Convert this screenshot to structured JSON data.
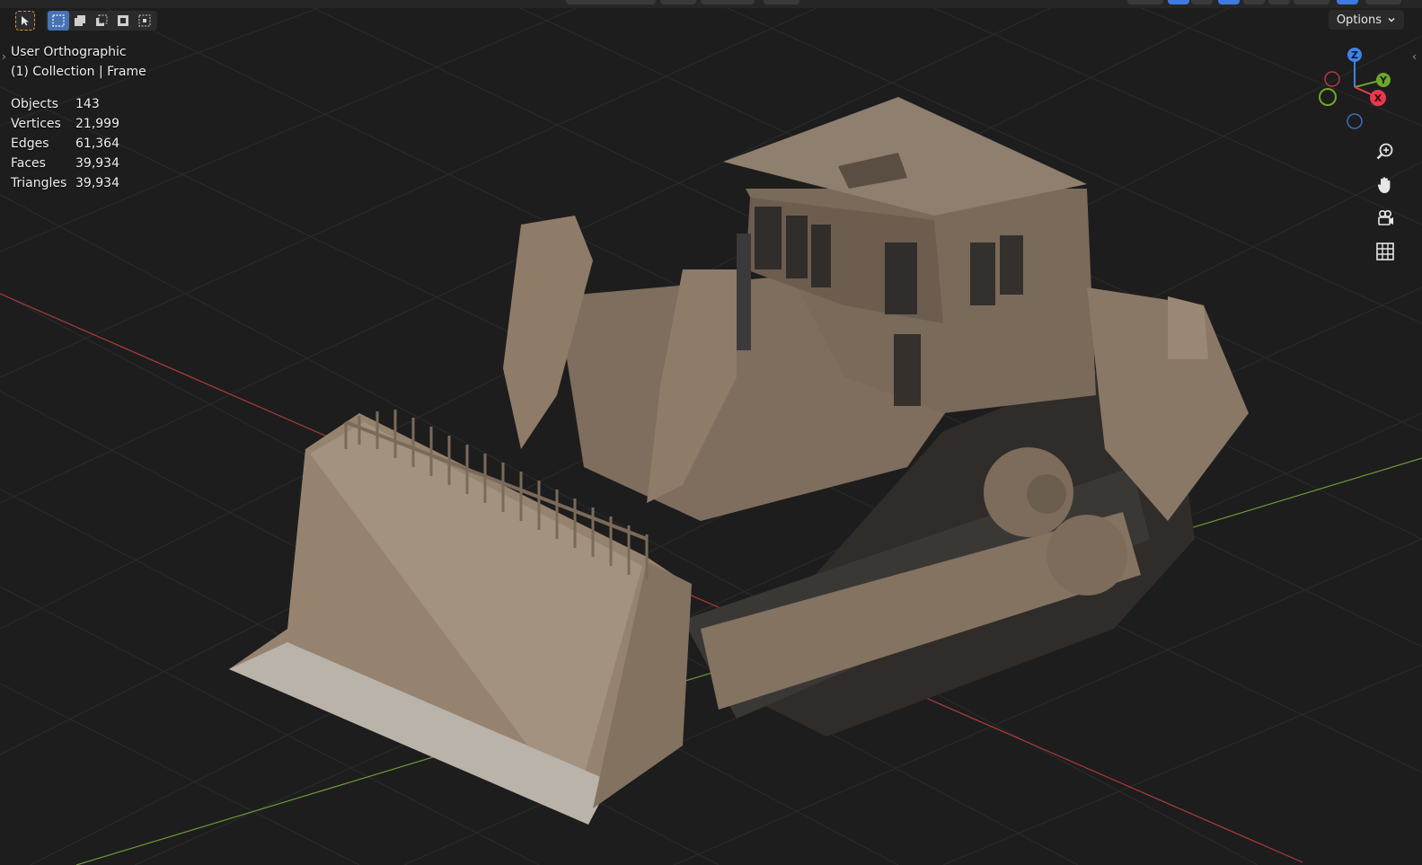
{
  "viewport": {
    "view_name": "User Orthographic",
    "collection_label": "(1) Collection | Frame",
    "stats": [
      {
        "label": "Objects",
        "value": "143"
      },
      {
        "label": "Vertices",
        "value": "21,999"
      },
      {
        "label": "Edges",
        "value": "61,364"
      },
      {
        "label": "Faces",
        "value": "39,934"
      },
      {
        "label": "Triangles",
        "value": "39,934"
      }
    ]
  },
  "header": {
    "options_label": "Options"
  },
  "gizmo": {
    "z_label": "Z",
    "y_label": "Y",
    "x_label": "X",
    "colors": {
      "x": "#e8394f",
      "y": "#6ea72a",
      "z": "#3f82e8"
    }
  },
  "nav_tools": [
    "zoom-icon",
    "hand-pan-icon",
    "camera-icon",
    "grid-ortho-icon"
  ],
  "colors": {
    "background": "#1d1d1d",
    "grid": "#2b2b2b",
    "x_axis": "#b03a3e",
    "y_axis": "#6d9a36",
    "model": "#8e7a66",
    "accent": "#4772b3"
  }
}
